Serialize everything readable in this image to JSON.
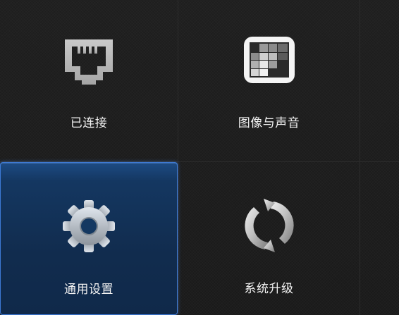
{
  "tiles": {
    "network": {
      "label": "已连接",
      "icon": "ethernet-port-icon"
    },
    "picture_sound": {
      "label": "图像与声音",
      "icon": "picture-grid-icon"
    },
    "general_settings": {
      "label": "通用设置",
      "icon": "gear-icon"
    },
    "system_upgrade": {
      "label": "系统升级",
      "icon": "refresh-icon"
    }
  },
  "colors": {
    "background": "#1b1b1b",
    "selected_tile": "#133358",
    "selected_border": "#3d7ad6",
    "label_text": "#f2f2f2"
  }
}
